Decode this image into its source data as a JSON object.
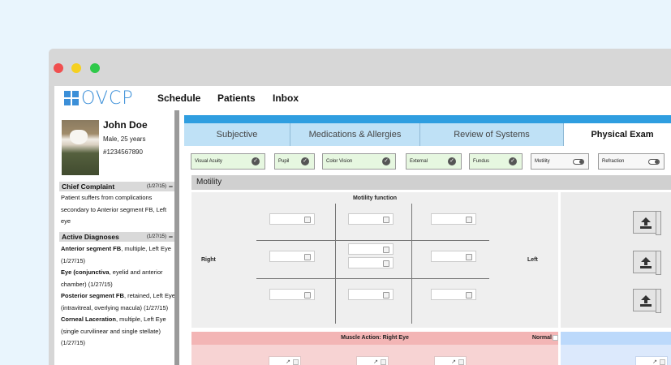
{
  "app": {
    "logo_text": "OVCP"
  },
  "nav": {
    "schedule": "Schedule",
    "patients": "Patients",
    "inbox": "Inbox"
  },
  "patient": {
    "name": "John Doe",
    "info": "Male, 25 years",
    "id": "#1234567890"
  },
  "chief_complaint": {
    "title": "Chief Complaint",
    "date": "(1/27/15)",
    "text": "Patient suffers from complications secondary to Anterior segment FB, Left eye"
  },
  "active_diagnoses": {
    "title": "Active Diagnoses",
    "date": "(1/27/15)",
    "items": [
      {
        "name": "Anterior segment FB",
        "detail": ", multiple, Left Eye (1/27/15)"
      },
      {
        "name": "Eye (conjunctiva",
        "detail": ", eyelid and anterior chamber) (1/27/15)"
      },
      {
        "name": "Posterior segment FB",
        "detail": ", retained, Left Eye (intravitreal, overlying macula) (1/27/15)"
      },
      {
        "name": "Corneal Laceration",
        "detail": ", multiple, Left Eye (single curvilinear and single stellate) (1/27/15)"
      }
    ]
  },
  "tabs": [
    "Subjective",
    "Medications & Allergies",
    "Review of Systems",
    "Physical Exam"
  ],
  "exam_chips": [
    {
      "label": "Visual Acuity",
      "status": "done"
    },
    {
      "label": "Pupil",
      "status": "done"
    },
    {
      "label": "Color Vision",
      "status": "done"
    },
    {
      "label": "External",
      "status": "done"
    },
    {
      "label": "Fundus",
      "status": "done"
    },
    {
      "label": "Motility",
      "status": "toggle"
    },
    {
      "label": "Refraction",
      "status": "toggle"
    }
  ],
  "motility": {
    "section_title": "Motility",
    "grid_title": "Motility function",
    "right_label": "Right",
    "left_label": "Left"
  },
  "muscle_action": {
    "title": "Muscle Action: Right Eye",
    "normal_label": "Normal"
  },
  "colors": {
    "accent_blue": "#2f9ee0",
    "tab_blue": "#bfe1f6",
    "logo_blue": "#3b8fd8",
    "chip_done": "#e6f7e0",
    "muscle_red": "#f3b5b5"
  }
}
